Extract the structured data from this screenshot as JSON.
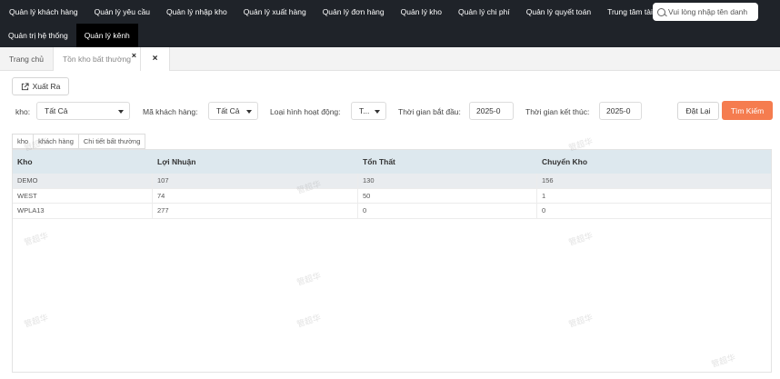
{
  "nav": {
    "row1": [
      "Quản lý khách hàng",
      "Quản lý yêu cầu",
      "Quản lý nhập kho",
      "Quản lý xuất hàng",
      "Quản lý đơn hàng",
      "Quản lý kho",
      "Quản lý chi phí",
      "Quản lý quyết toán",
      "Trung tâm tài chín"
    ],
    "row2": [
      "Quản trị hệ thống",
      "Quản lý kênh"
    ],
    "search_placeholder": "Vui lòng nhập tên danh"
  },
  "tabs": {
    "home": "Trang chủ",
    "current": "Tồn kho bất thường",
    "current_close": "×",
    "close_all": "×"
  },
  "toolbar": {
    "export_label": "Xuất Ra"
  },
  "filters": {
    "warehouse_label": "kho:",
    "warehouse_value": "Tất Cả",
    "customer_label": "Mã khách hàng:",
    "customer_value": "Tất Cả",
    "activity_label": "Loại hình hoạt động:",
    "activity_value": "T...",
    "start_label": "Thời gian bắt đầu:",
    "start_value": "2025-0",
    "end_label": "Thời gian kết thúc:",
    "end_value": "2025-0",
    "reset_label": "Đặt Lại",
    "search_label": "Tìm Kiếm"
  },
  "subtabs": [
    "kho",
    "khách hàng",
    "Chi tiết bất thường"
  ],
  "table": {
    "headers": [
      "Kho",
      "Lợi Nhuận",
      "Tổn Thất",
      "Chuyển Kho"
    ],
    "rows": [
      [
        "DEMO",
        "107",
        "130",
        "156"
      ],
      [
        "WEST",
        "74",
        "50",
        "1"
      ],
      [
        "WPLA13",
        "277",
        "0",
        "0"
      ]
    ]
  },
  "watermark_text": "管超华",
  "colors": {
    "nav_bg": "#1f2329",
    "accent": "#f57c4f",
    "table_header": "#dde8ee"
  }
}
